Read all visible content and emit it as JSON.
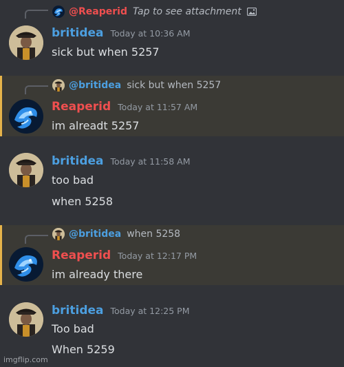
{
  "messages": [
    {
      "reply": {
        "name": "@Reaperid",
        "text": "Tap to see attachment",
        "attachment_icon": "image-icon"
      },
      "author": "britidea",
      "timestamp": "Today at 10:36 AM",
      "lines": [
        "sick but when 5257"
      ]
    },
    {
      "reply": {
        "name": "@britidea",
        "text": "sick but when 5257"
      },
      "author": "Reaperid",
      "timestamp": "Today at 11:57 AM",
      "lines": [
        "im alreadt 5257"
      ]
    },
    {
      "author": "britidea",
      "timestamp": "Today at 11:58 AM",
      "lines": [
        "too bad",
        "when 5258"
      ]
    },
    {
      "reply": {
        "name": "@britidea",
        "text": "when 5258"
      },
      "author": "Reaperid",
      "timestamp": "Today at 12:17 PM",
      "lines": [
        "im already there"
      ]
    },
    {
      "author": "britidea",
      "timestamp": "Today at 12:25 PM",
      "lines": [
        "Too bad",
        "When 5259"
      ]
    }
  ],
  "watermark": "imgflip.com",
  "colors": {
    "background": "#313338",
    "highlight_background": "#3b3a35",
    "highlight_bar": "#e6b34a",
    "britidea_name": "#4c9fe0",
    "reaperid_name": "#ef4f4f",
    "timestamp": "#949ba4"
  }
}
